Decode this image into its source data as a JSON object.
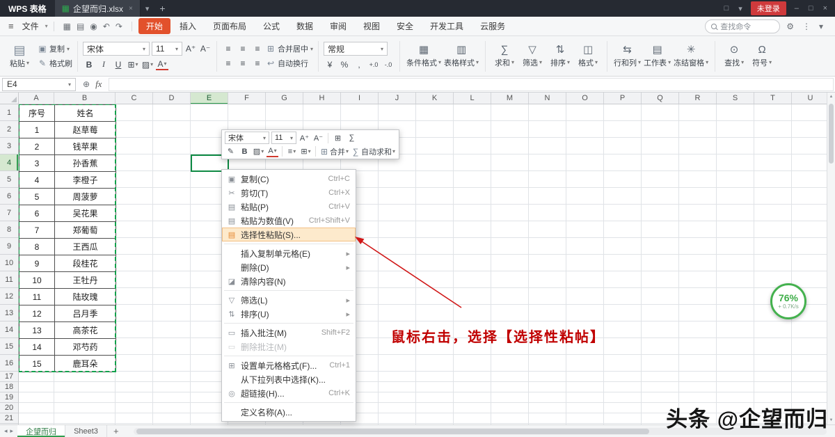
{
  "titlebar": {
    "app_name": "WPS 表格",
    "doc_tab": "企望而归.xlsx",
    "login_button": "未登录"
  },
  "menubar": {
    "file": "文件",
    "items": [
      "开始",
      "插入",
      "页面布局",
      "公式",
      "数据",
      "审阅",
      "视图",
      "安全",
      "开发工具",
      "云服务"
    ],
    "active": "开始",
    "search": "查找命令"
  },
  "toolbar": {
    "paste": "粘贴",
    "copy": "复制",
    "format_painter": "格式刷",
    "font_name": "宋体",
    "font_size": "11",
    "merge_center": "合并居中",
    "wrap_text": "自动换行",
    "number_format": "常规",
    "big_buttons": [
      {
        "label": "条件格式",
        "icon": "cond-format"
      },
      {
        "label": "表格样式",
        "icon": "table-style"
      },
      {
        "label": "求和",
        "icon": "sum"
      },
      {
        "label": "筛选",
        "icon": "filter"
      },
      {
        "label": "排序",
        "icon": "sort"
      },
      {
        "label": "格式",
        "icon": "format"
      },
      {
        "label": "行和列",
        "icon": "rows-cols"
      },
      {
        "label": "工作表",
        "icon": "worksheet"
      },
      {
        "label": "冻结窗格",
        "icon": "freeze"
      },
      {
        "label": "查找",
        "icon": "find"
      },
      {
        "label": "符号",
        "icon": "symbol"
      }
    ]
  },
  "formula_bar": {
    "cell_ref": "E4",
    "fx_label": "fx"
  },
  "grid": {
    "columns": [
      "A",
      "B",
      "C",
      "D",
      "E",
      "F",
      "G",
      "H",
      "I",
      "J",
      "K",
      "L",
      "M",
      "N",
      "O",
      "P",
      "Q",
      "R",
      "S",
      "T",
      "U"
    ],
    "row_count": 21,
    "selected_col": "E",
    "selected_row": 4,
    "table": {
      "headers": [
        "序号",
        "姓名"
      ],
      "rows": [
        [
          "1",
          "赵草莓"
        ],
        [
          "2",
          "钱苹果"
        ],
        [
          "3",
          "孙香蕉"
        ],
        [
          "4",
          "李橙子"
        ],
        [
          "5",
          "周菠萝"
        ],
        [
          "6",
          "吴花果"
        ],
        [
          "7",
          "郑葡萄"
        ],
        [
          "8",
          "王西瓜"
        ],
        [
          "9",
          "段桂花"
        ],
        [
          "10",
          "王牡丹"
        ],
        [
          "11",
          "陆玫瑰"
        ],
        [
          "12",
          "吕月季"
        ],
        [
          "13",
          "高茶花"
        ],
        [
          "14",
          "邓芍药"
        ],
        [
          "15",
          "鹿耳朵"
        ]
      ]
    }
  },
  "context_menu": {
    "mini_toolbar": {
      "font_name": "宋体",
      "font_size": "11",
      "merge": "合并",
      "autosum": "自动求和"
    },
    "items": [
      {
        "name": "copy",
        "label": "复制(C)",
        "shortcut": "Ctrl+C",
        "icon": "copy"
      },
      {
        "name": "cut",
        "label": "剪切(T)",
        "shortcut": "Ctrl+X",
        "icon": "cut"
      },
      {
        "name": "paste",
        "label": "粘贴(P)",
        "shortcut": "Ctrl+V",
        "icon": "paste"
      },
      {
        "name": "paste-values",
        "label": "粘贴为数值(V)",
        "shortcut": "Ctrl+Shift+V",
        "icon": "paste"
      },
      {
        "name": "paste-special",
        "label": "选择性粘贴(S)...",
        "icon": "paste-special",
        "highlighted": true
      },
      {
        "separator": true
      },
      {
        "name": "insert-copied-cells",
        "label": "插入复制单元格(E)",
        "submenu": true
      },
      {
        "name": "delete",
        "label": "删除(D)",
        "submenu": true
      },
      {
        "name": "clear-contents",
        "label": "清除内容(N)",
        "icon": "clear"
      },
      {
        "separator": true
      },
      {
        "name": "filter",
        "label": "筛选(L)",
        "icon": "filter",
        "submenu": true
      },
      {
        "name": "sort",
        "label": "排序(U)",
        "icon": "sort",
        "submenu": true
      },
      {
        "separator": true
      },
      {
        "name": "insert-comment",
        "label": "插入批注(M)",
        "shortcut": "Shift+F2",
        "icon": "comment"
      },
      {
        "name": "delete-comment",
        "label": "删除批注(M)",
        "icon": "comment",
        "disabled": true
      },
      {
        "separator": true
      },
      {
        "name": "format-cells",
        "label": "设置单元格格式(F)...",
        "shortcut": "Ctrl+1",
        "icon": "format-cells"
      },
      {
        "name": "pick-from-list",
        "label": "从下拉列表中选择(K)..."
      },
      {
        "name": "hyperlink",
        "label": "超链接(H)...",
        "shortcut": "Ctrl+K",
        "icon": "link"
      },
      {
        "separator": true
      },
      {
        "name": "define-name",
        "label": "定义名称(A)..."
      }
    ]
  },
  "annotation": {
    "text": "鼠标右击，选择【选择性粘帖】",
    "color": "#c00000"
  },
  "download_badge": {
    "percent": "76%",
    "speed": "+ 0.7K/s"
  },
  "sheet_tabs": {
    "tabs": [
      "企望而归",
      "Sheet3"
    ],
    "active": "企望而归"
  },
  "watermark": "头条 @企望而归"
}
